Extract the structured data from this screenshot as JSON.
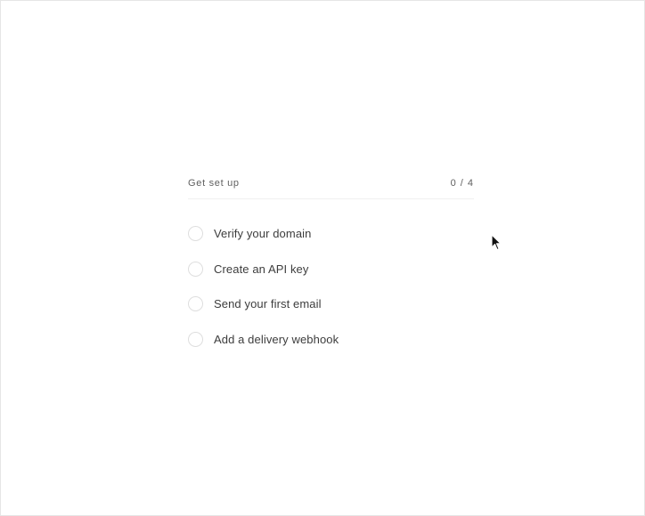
{
  "setup": {
    "title": "Get set up",
    "progress": "0 / 4",
    "tasks": [
      {
        "label": "Verify your domain",
        "completed": false
      },
      {
        "label": "Create an API key",
        "completed": false
      },
      {
        "label": "Send your first email",
        "completed": false
      },
      {
        "label": "Add a delivery webhook",
        "completed": false
      }
    ]
  },
  "icons": {
    "cursor": "mouse-pointer-icon",
    "checkbox": "empty-circle-checkbox"
  },
  "colors": {
    "background": "#ffffff",
    "text": "#3d3d3d",
    "muted": "#5f5f5f",
    "border": "#dedede"
  }
}
